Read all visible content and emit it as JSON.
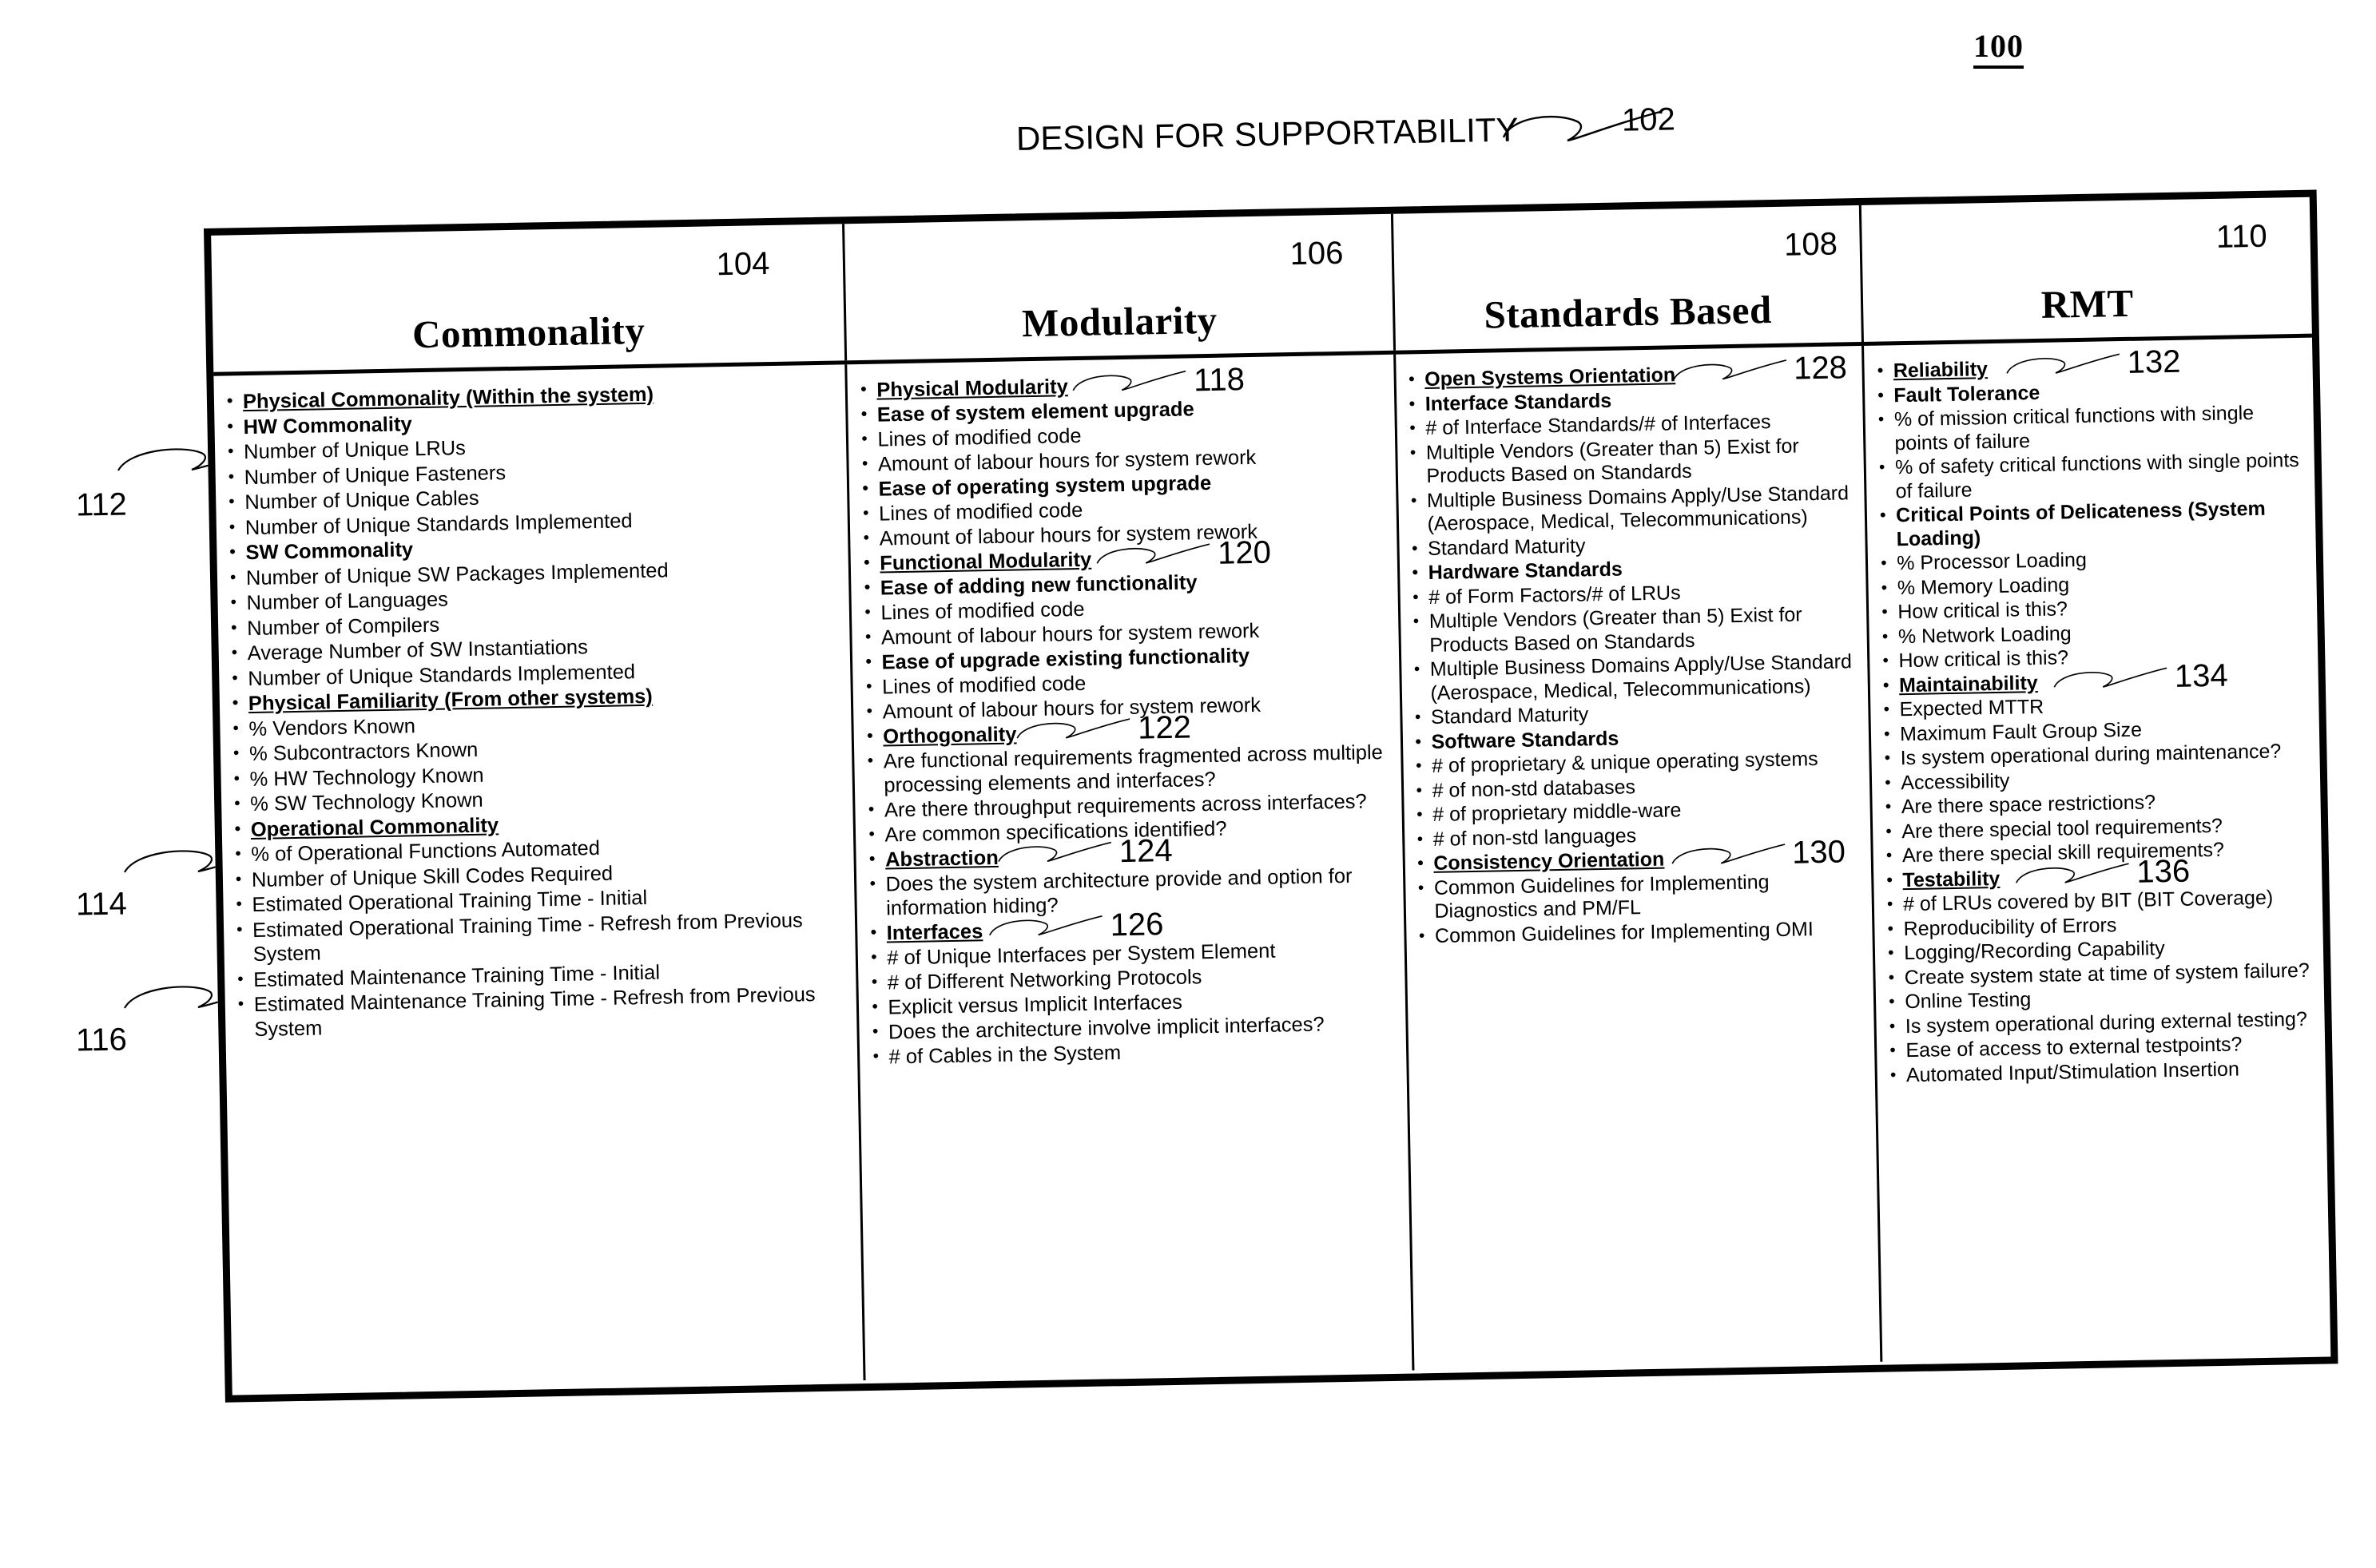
{
  "figure": {
    "number": "100",
    "title": "DESIGN FOR SUPPORTABILITY",
    "title_ref": "102"
  },
  "side_refs": [
    {
      "label": "112"
    },
    {
      "label": "114"
    },
    {
      "label": "116"
    }
  ],
  "columns": [
    {
      "title": "Commonality",
      "ref": "104",
      "items": [
        {
          "level": 1,
          "text": "Physical Commonality (Within the system)"
        },
        {
          "level": "2b",
          "text": "HW Commonality"
        },
        {
          "level": 2,
          "text": "Number of Unique LRUs"
        },
        {
          "level": 2,
          "text": "Number of Unique Fasteners"
        },
        {
          "level": 2,
          "text": "Number of Unique Cables"
        },
        {
          "level": 2,
          "text": "Number of Unique Standards Implemented"
        },
        {
          "level": "2b",
          "text": "SW Commonality"
        },
        {
          "level": 2,
          "text": "Number of Unique SW Packages Implemented"
        },
        {
          "level": 2,
          "text": "Number of Languages"
        },
        {
          "level": 2,
          "text": "Number of Compilers"
        },
        {
          "level": 2,
          "text": "Average Number of SW Instantiations"
        },
        {
          "level": 2,
          "text": "Number of Unique Standards Implemented"
        },
        {
          "level": 1,
          "text": "Physical Familiarity (From other systems)"
        },
        {
          "level": 2,
          "text": "% Vendors Known"
        },
        {
          "level": 2,
          "text": "% Subcontractors Known"
        },
        {
          "level": 2,
          "text": "% HW Technology Known"
        },
        {
          "level": 2,
          "text": "% SW Technology Known"
        },
        {
          "level": 1,
          "text": "Operational Commonality"
        },
        {
          "level": 2,
          "text": "% of Operational Functions Automated"
        },
        {
          "level": 2,
          "text": "Number of Unique Skill Codes Required"
        },
        {
          "level": 2,
          "text": "Estimated Operational Training Time - Initial"
        },
        {
          "level": 2,
          "text": "Estimated Operational Training Time - Refresh from Previous System"
        },
        {
          "level": 2,
          "text": "Estimated Maintenance Training Time - Initial"
        },
        {
          "level": 2,
          "text": "Estimated Maintenance Training Time - Refresh from Previous System"
        }
      ]
    },
    {
      "title": "Modularity",
      "ref": "106",
      "items": [
        {
          "level": 1,
          "text": "Physical Modularity",
          "ref": "118"
        },
        {
          "level": "2b",
          "text": "Ease of system element upgrade"
        },
        {
          "level": 2,
          "text": "Lines of modified code"
        },
        {
          "level": 2,
          "text": "Amount of labour hours for system rework"
        },
        {
          "level": "2b",
          "text": "Ease of operating system upgrade"
        },
        {
          "level": 2,
          "text": "Lines of modified code"
        },
        {
          "level": 2,
          "text": "Amount of labour hours for system rework"
        },
        {
          "level": 1,
          "text": "Functional Modularity",
          "ref": "120"
        },
        {
          "level": "2b",
          "text": "Ease of adding new functionality"
        },
        {
          "level": 2,
          "text": "Lines of modified code"
        },
        {
          "level": 2,
          "text": "Amount of labour hours for system rework"
        },
        {
          "level": "2b",
          "text": "Ease of upgrade existing functionality"
        },
        {
          "level": 2,
          "text": "Lines of modified code"
        },
        {
          "level": 2,
          "text": "Amount of labour hours for system rework"
        },
        {
          "level": 1,
          "text": "Orthogonality",
          "ref": "122"
        },
        {
          "level": 2,
          "text": "Are functional requirements fragmented across multiple processing elements and interfaces?"
        },
        {
          "level": 2,
          "text": "Are there throughput requirements across interfaces?"
        },
        {
          "level": 2,
          "text": "Are common specifications identified?"
        },
        {
          "level": 1,
          "text": "Abstraction",
          "ref": "124"
        },
        {
          "level": 2,
          "text": "Does the system architecture provide and option for information hiding?"
        },
        {
          "level": 1,
          "text": "Interfaces",
          "ref": "126"
        },
        {
          "level": 2,
          "text": "# of Unique Interfaces per System Element"
        },
        {
          "level": 2,
          "text": "# of Different Networking Protocols"
        },
        {
          "level": 2,
          "text": "Explicit versus Implicit Interfaces"
        },
        {
          "level": 2,
          "text": "Does the architecture involve implicit interfaces?"
        },
        {
          "level": 2,
          "text": "# of Cables in the System"
        }
      ]
    },
    {
      "title": "Standards Based",
      "ref": "108",
      "items": [
        {
          "level": 1,
          "text": "Open Systems Orientation",
          "ref": "128"
        },
        {
          "level": "2b",
          "text": "Interface Standards"
        },
        {
          "level": 2,
          "text": "# of Interface Standards/# of Interfaces"
        },
        {
          "level": 2,
          "text": "Multiple Vendors (Greater than 5) Exist for Products Based on Standards"
        },
        {
          "level": 2,
          "text": "Multiple Business Domains Apply/Use Standard (Aerospace, Medical, Telecommunications)"
        },
        {
          "level": 2,
          "text": "Standard Maturity"
        },
        {
          "level": "2b",
          "text": "Hardware Standards"
        },
        {
          "level": 2,
          "text": "# of Form Factors/# of LRUs"
        },
        {
          "level": 2,
          "text": "Multiple Vendors (Greater than 5) Exist for Products Based on Standards"
        },
        {
          "level": 2,
          "text": "Multiple Business Domains Apply/Use Standard (Aerospace, Medical, Telecommunications)"
        },
        {
          "level": 2,
          "text": "Standard Maturity"
        },
        {
          "level": "2b",
          "text": "Software Standards"
        },
        {
          "level": 2,
          "text": "# of proprietary & unique operating systems"
        },
        {
          "level": 2,
          "text": "# of non-std databases"
        },
        {
          "level": 2,
          "text": "# of proprietary middle-ware"
        },
        {
          "level": 2,
          "text": "# of non-std languages"
        },
        {
          "level": 1,
          "text": "Consistency Orientation",
          "ref": "130"
        },
        {
          "level": 2,
          "text": "Common Guidelines for Implementing Diagnostics and PM/FL"
        },
        {
          "level": 2,
          "text": "Common Guidelines for Implementing OMI"
        }
      ]
    },
    {
      "title": "RMT",
      "ref": "110",
      "items": [
        {
          "level": 1,
          "text": "Reliability",
          "ref": "132"
        },
        {
          "level": "2b",
          "text": "Fault Tolerance"
        },
        {
          "level": 2,
          "text": "%  of mission critical functions with single points of failure"
        },
        {
          "level": 2,
          "text": "%  of safety critical functions with single points of failure"
        },
        {
          "level": "2b",
          "text": "Critical Points of Delicateness (System Loading)"
        },
        {
          "level": 2,
          "text": "% Processor Loading"
        },
        {
          "level": 2,
          "text": "% Memory Loading"
        },
        {
          "level": 2,
          "text": "How critical is this?"
        },
        {
          "level": 2,
          "text": "% Network Loading"
        },
        {
          "level": 2,
          "text": "How critical is this?"
        },
        {
          "level": 1,
          "text": "Maintainability",
          "ref": "134"
        },
        {
          "level": 2,
          "text": "Expected MTTR"
        },
        {
          "level": 2,
          "text": "Maximum Fault Group Size"
        },
        {
          "level": 2,
          "text": "Is system operational during maintenance?"
        },
        {
          "level": 2,
          "text": "Accessibility"
        },
        {
          "level": 3,
          "text": "Are there space restrictions?"
        },
        {
          "level": 3,
          "text": "Are there special tool requirements?"
        },
        {
          "level": 3,
          "text": "Are there special skill requirements?"
        },
        {
          "level": 1,
          "text": "Testability",
          "ref": "136"
        },
        {
          "level": 2,
          "text": "# of LRUs covered by BIT (BIT Coverage)"
        },
        {
          "level": 2,
          "text": "Reproducibility of Errors"
        },
        {
          "level": 3,
          "text": "Logging/Recording Capability"
        },
        {
          "level": 3,
          "text": "Create system state at time of system failure?"
        },
        {
          "level": 2,
          "text": "Online Testing"
        },
        {
          "level": 3,
          "text": "Is system operational during external testing?"
        },
        {
          "level": 3,
          "text": "Ease of access to external testpoints?"
        },
        {
          "level": 2,
          "text": "Automated Input/Stimulation Insertion"
        }
      ]
    }
  ],
  "colors": {
    "ink": "#000000",
    "paper": "#ffffff"
  }
}
